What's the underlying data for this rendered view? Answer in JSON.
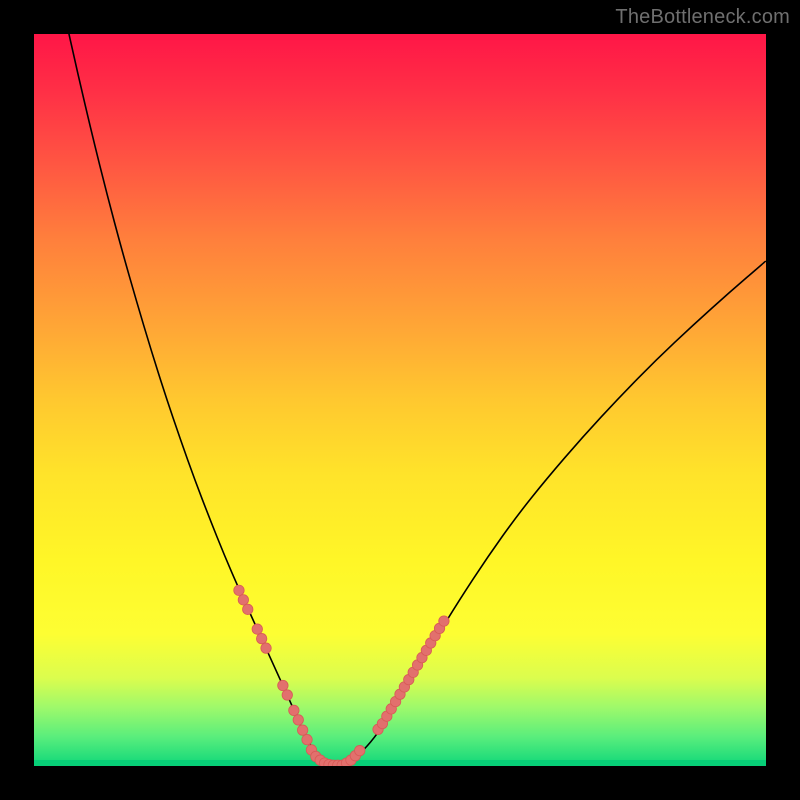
{
  "watermark": {
    "text": "TheBottleneck.com"
  },
  "colors": {
    "curve_stroke": "#000000",
    "dot_fill": "#e2706d",
    "dot_stroke": "#d85a57"
  },
  "chart_data": {
    "type": "line",
    "title": "",
    "xlabel": "",
    "ylabel": "",
    "xlim": [
      0,
      100
    ],
    "ylim": [
      0,
      100
    ],
    "grid": false,
    "legend": false,
    "series": [
      {
        "name": "bottleneck-curve",
        "x": [
          0,
          2,
          4,
          6,
          8,
          10,
          12,
          14,
          16,
          18,
          20,
          22,
          24,
          26,
          28,
          29,
          30,
          31,
          32,
          33,
          34,
          35,
          36,
          37,
          38,
          39,
          40,
          41,
          42,
          44,
          46,
          48,
          50,
          52,
          55,
          58,
          62,
          66,
          70,
          75,
          80,
          85,
          90,
          95,
          100
        ],
        "values": [
          124,
          113,
          103.5,
          94.5,
          86,
          78,
          70.5,
          63.5,
          56.8,
          50.5,
          44.6,
          39,
          33.8,
          28.8,
          24.2,
          22,
          19.8,
          17.6,
          15.4,
          13.2,
          11,
          8.8,
          6.5,
          4.2,
          2.5,
          1.2,
          0.4,
          0.1,
          0.1,
          1.2,
          3.2,
          6,
          9.2,
          12.6,
          17.6,
          22.5,
          28.6,
          34.2,
          39.2,
          45,
          50.4,
          55.5,
          60.2,
          64.7,
          69
        ]
      }
    ],
    "dots": {
      "name": "highlight-dots",
      "x": [
        28.0,
        28.6,
        29.2,
        30.5,
        31.1,
        31.7,
        34.0,
        34.6,
        35.5,
        36.1,
        36.7,
        37.3,
        37.9,
        38.5,
        39.1,
        39.7,
        40.3,
        40.9,
        41.5,
        42.1,
        42.7,
        43.3,
        43.9,
        44.5,
        47.0,
        47.6,
        48.2,
        48.8,
        49.4,
        50.0,
        50.6,
        51.2,
        51.8,
        52.4,
        53.0,
        53.6,
        54.2,
        54.8,
        55.4,
        56.0
      ],
      "values": [
        24.0,
        22.7,
        21.4,
        18.7,
        17.4,
        16.1,
        11.0,
        9.7,
        7.6,
        6.3,
        4.9,
        3.6,
        2.2,
        1.3,
        0.8,
        0.4,
        0.2,
        0.1,
        0.1,
        0.1,
        0.4,
        0.8,
        1.4,
        2.1,
        5.0,
        5.8,
        6.8,
        7.8,
        8.8,
        9.8,
        10.8,
        11.8,
        12.8,
        13.8,
        14.8,
        15.8,
        16.8,
        17.8,
        18.8,
        19.8
      ]
    }
  }
}
